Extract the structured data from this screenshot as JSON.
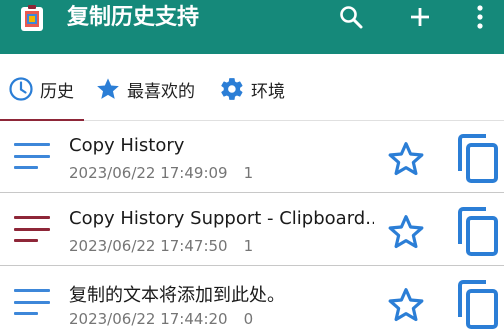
{
  "app": {
    "title": "复制历史支持",
    "icon": "clipboard-app-icon",
    "bar_color": "#15897a",
    "actions": [
      "search-icon",
      "add-icon",
      "more-vert-icon"
    ]
  },
  "tabs": [
    {
      "label": "历史",
      "icon": "clock-icon",
      "selected": true
    },
    {
      "label": "最喜欢的",
      "icon": "star-icon",
      "selected": false
    },
    {
      "label": "环境",
      "icon": "gear-icon",
      "selected": false
    }
  ],
  "colors": {
    "accent_blue": "#2b7ed6",
    "tab_indicator": "#8e2638",
    "menu_blue": "#3d87d9",
    "menu_maroon": "#8e2638"
  },
  "items": [
    {
      "title": "Copy History",
      "date": "2023/06/22 17:49:09",
      "count": "1",
      "menu_color": "#3d87d9",
      "favorite": false
    },
    {
      "title": "Copy History Support - Clipboard..",
      "date": "2023/06/22 17:47:50",
      "count": "1",
      "menu_color": "#8e2638",
      "favorite": false
    },
    {
      "title": "复制的文本将添加到此处。",
      "date": "2023/06/22 17:44:20",
      "count": "0",
      "menu_color": "#3d87d9",
      "favorite": false
    }
  ]
}
